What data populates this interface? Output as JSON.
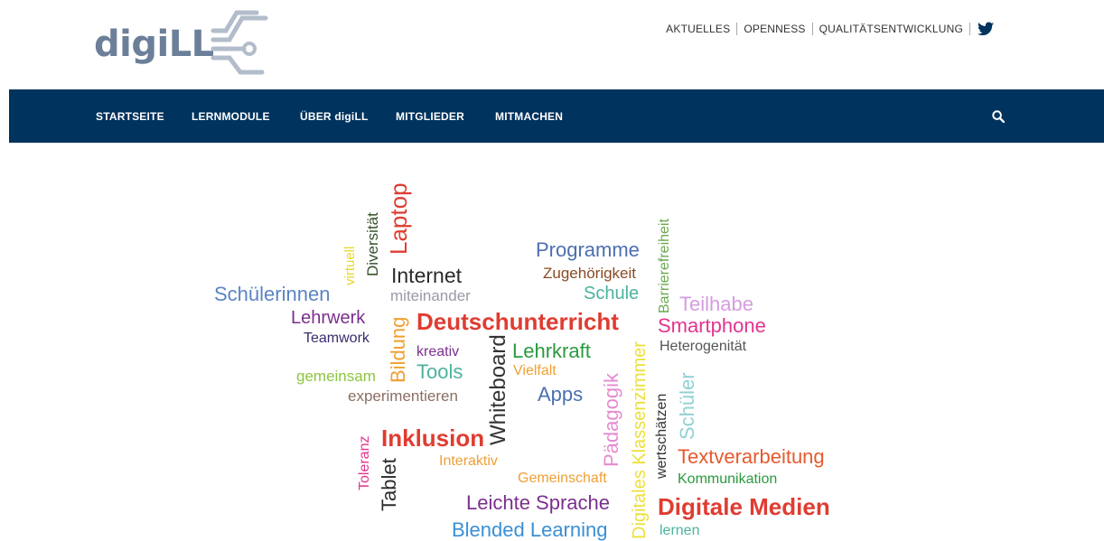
{
  "logo": {
    "text": "digiLL"
  },
  "topnav": {
    "items": [
      "AKTUELLES",
      "OPENNESS",
      "QUALITÄTSENTWICKLUNG"
    ],
    "twitter_icon": "twitter-icon"
  },
  "mainnav": {
    "items": [
      "STARTSEITE",
      "LERNMODULE",
      "ÜBER digiLL",
      "MITGLIEDER",
      "MITMACHEN"
    ],
    "search_icon": "search-icon",
    "background": "#00335e"
  },
  "wordcloud": {
    "words": [
      "Laptop",
      "Diversität",
      "virtuell",
      "Internet",
      "Schülerinnen",
      "miteinander",
      "Programme",
      "Zugehörigkeit",
      "Schule",
      "Barrierefreiheit",
      "Teilhabe",
      "Lehrwerk",
      "Bildung",
      "Deutschunterricht",
      "Smartphone",
      "Teamwork",
      "kreativ",
      "Lehrkraft",
      "Heterogenität",
      "Whiteboard",
      "gemeinsam",
      "Tools",
      "Vielfalt",
      "Digitales Klassenzimmer",
      "experimentieren",
      "Apps",
      "Pädagogik",
      "Schüler",
      "wertschätzen",
      "Toleranz",
      "Inklusion",
      "Tablet",
      "Interaktiv",
      "Textverarbeitung",
      "Gemeinschaft",
      "Kommunikation",
      "Leichte Sprache",
      "Digitale Medien",
      "Blended Learning",
      "lernen"
    ]
  }
}
